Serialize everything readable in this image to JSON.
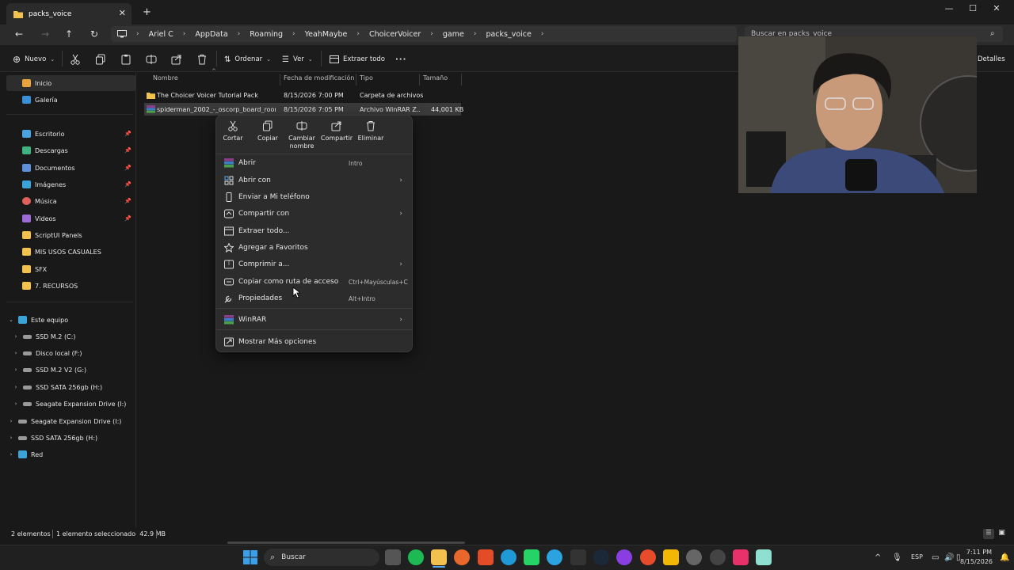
{
  "window": {
    "tab_title": "packs_voice",
    "close_tab": "✕",
    "new_tab": "+",
    "minimize": "—",
    "maximize": "☐",
    "close": "✕"
  },
  "address": {
    "crumbs": [
      "Ariel C",
      "AppData",
      "Roaming",
      "YeahMaybe",
      "ChoicerVoicer",
      "game",
      "packs_voice"
    ],
    "search_placeholder": "Buscar en packs_voice"
  },
  "toolbar": {
    "new_label": "Nuevo",
    "sort_label": "Ordenar",
    "view_label": "Ver",
    "extract_label": "Extraer todo",
    "more_label": "···",
    "details_label": "Detalles"
  },
  "sidebar": {
    "top": [
      {
        "label": "Inicio",
        "color": "#e8a33d"
      },
      {
        "label": "Galería",
        "color": "#3b8fd9"
      }
    ],
    "pinned": [
      {
        "label": "Escritorio",
        "color": "#4aa3e0"
      },
      {
        "label": "Descargas",
        "color": "#3fb37f"
      },
      {
        "label": "Documentos",
        "color": "#5f8fd8"
      },
      {
        "label": "Imágenes",
        "color": "#3aa4d8"
      },
      {
        "label": "Música",
        "color": "#e0605a"
      },
      {
        "label": "Videos",
        "color": "#9b6cd8"
      }
    ],
    "folders": [
      {
        "label": "ScriptUI Panels"
      },
      {
        "label": "MIS USOS CASUALES"
      },
      {
        "label": "SFX"
      },
      {
        "label": "7. RECURSOS"
      }
    ],
    "this_pc": "Este equipo",
    "drives": [
      {
        "label": "SSD M.2 (C:)"
      },
      {
        "label": "Disco local (F:)"
      },
      {
        "label": "SSD M.2 V2 (G:)"
      },
      {
        "label": "SSD SATA 256gb (H:)"
      },
      {
        "label": "Seagate Expansion Drive (I:)"
      }
    ],
    "root_drives": [
      {
        "label": "Seagate Expansion Drive (I:)"
      },
      {
        "label": "SSD SATA 256gb (H:)"
      }
    ],
    "network": "Red"
  },
  "files": {
    "columns": [
      "Nombre",
      "Fecha de modificación",
      "Tipo",
      "Tamaño"
    ],
    "rows": [
      {
        "name": "The Choicer Voicer Tutorial Pack",
        "date": "8/15/2026 7:00 PM",
        "type": "Carpeta de archivos",
        "size": ""
      },
      {
        "name": "spiderman_2002_-_oscorp_board_room_...",
        "date": "8/15/2026 7:05 PM",
        "type": "Archivo WinRAR Z...",
        "size": "44,001 KB"
      }
    ]
  },
  "context_menu": {
    "quick_actions": [
      {
        "label": "Cortar",
        "icon": "cut-icon"
      },
      {
        "label": "Copiar",
        "icon": "copy-icon"
      },
      {
        "label": "Cambiar nombre",
        "icon": "rename-icon"
      },
      {
        "label": "Compartir",
        "icon": "share-icon"
      },
      {
        "label": "Eliminar",
        "icon": "delete-icon"
      }
    ],
    "items": [
      {
        "label": "Abrir",
        "accel": "Intro",
        "arrow": ""
      },
      {
        "label": "Abrir con",
        "accel": "",
        "arrow": "›"
      },
      {
        "label": "Enviar a Mi teléfono",
        "accel": "",
        "arrow": ""
      },
      {
        "label": "Compartir con",
        "accel": "",
        "arrow": "›"
      },
      {
        "label": "Extraer todo...",
        "accel": "",
        "arrow": ""
      },
      {
        "label": "Agregar a Favoritos",
        "accel": "",
        "arrow": ""
      },
      {
        "label": "Comprimir a...",
        "accel": "",
        "arrow": "›"
      },
      {
        "label": "Copiar como ruta de acceso",
        "accel": "Ctrl+Mayúsculas+C",
        "arrow": ""
      },
      {
        "label": "Propiedades",
        "accel": "Alt+Intro",
        "arrow": ""
      },
      {
        "label": "WinRAR",
        "accel": "",
        "arrow": "›"
      },
      {
        "label": "Mostrar Más opciones",
        "accel": "",
        "arrow": ""
      }
    ]
  },
  "status": {
    "count": "2 elementos",
    "selection": "1 elemento seleccionado  42.9 MB"
  },
  "taskbar": {
    "search_label": "Buscar",
    "lang": "ESP",
    "time": "7:11 PM",
    "date": "8/15/2026"
  },
  "colors": {
    "accent": "#0067c0",
    "folder": "#f2c14e"
  }
}
